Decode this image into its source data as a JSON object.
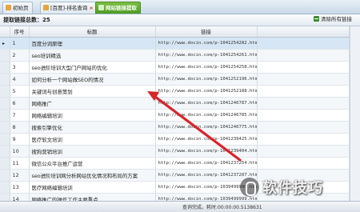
{
  "tabs": [
    {
      "label": "初始页"
    },
    {
      "label": "[百度]-排名查询"
    },
    {
      "label": "网站链接提取"
    }
  ],
  "header": {
    "count_label": "提取链接总数：25",
    "clear_label": "清除所有链接"
  },
  "table": {
    "columns": [
      "序号",
      "标题",
      "链接"
    ],
    "rows": [
      {
        "num": "1",
        "title": "百度分词原理",
        "url": "http://www.docin.com/p-1041254282.html"
      },
      {
        "num": "2",
        "title": "seo培训精选",
        "url": "http://www.docin.com/p-1041254261.html"
      },
      {
        "num": "3",
        "title": "seo进阶培训大型门户网站的优化",
        "url": "http://www.docin.com/p-1041254258.html"
      },
      {
        "num": "4",
        "title": "如何分析一个网站做SEO的情况",
        "url": "http://www.docin.com/p-1041252196.html"
      },
      {
        "num": "5",
        "title": "关键词与创意策划",
        "url": "http://www.docin.com/p-1041252188.html"
      },
      {
        "num": "6",
        "title": "网络推广",
        "url": "http://www.docin.com/p-1041246787.html"
      },
      {
        "num": "7",
        "title": "网络编辑培训",
        "url": "http://www.docin.com/p-1041246785.html"
      },
      {
        "num": "8",
        "title": "搜索引擎优化",
        "url": "http://www.docin.com/p-1041246775.html"
      },
      {
        "num": "9",
        "title": "医疗软文培训",
        "url": "http://www.docin.com/p-1041239425.html"
      },
      {
        "num": "10",
        "title": "搜狗营销培训",
        "url": "http://www.docin.com/p-1041239404.html"
      },
      {
        "num": "11",
        "title": "微信公众平台推广运营",
        "url": "http://www.docin.com/p-1041237254.html"
      },
      {
        "num": "12",
        "title": "seo进阶培训网分析网站优化情况和布局的方案",
        "url": "http://www.docin.com/p-1041237207.html"
      },
      {
        "num": "13",
        "title": "医疗网络编辑培训",
        "url": "http://www.docin.com/p-1039499990.html"
      },
      {
        "num": "14",
        "title": "网络推广的操作工作主要重点",
        "url": "http://www.docin.com/p-1039499999.html"
      }
    ]
  },
  "status": {
    "text": "查询完成，耗时:00:00:00.5138631"
  },
  "watermark": {
    "text": "软件技巧"
  },
  "colors": {
    "active_tab": "#5aa52c",
    "arrow": "#d9252a",
    "header_bg": "#e4ebf2"
  }
}
